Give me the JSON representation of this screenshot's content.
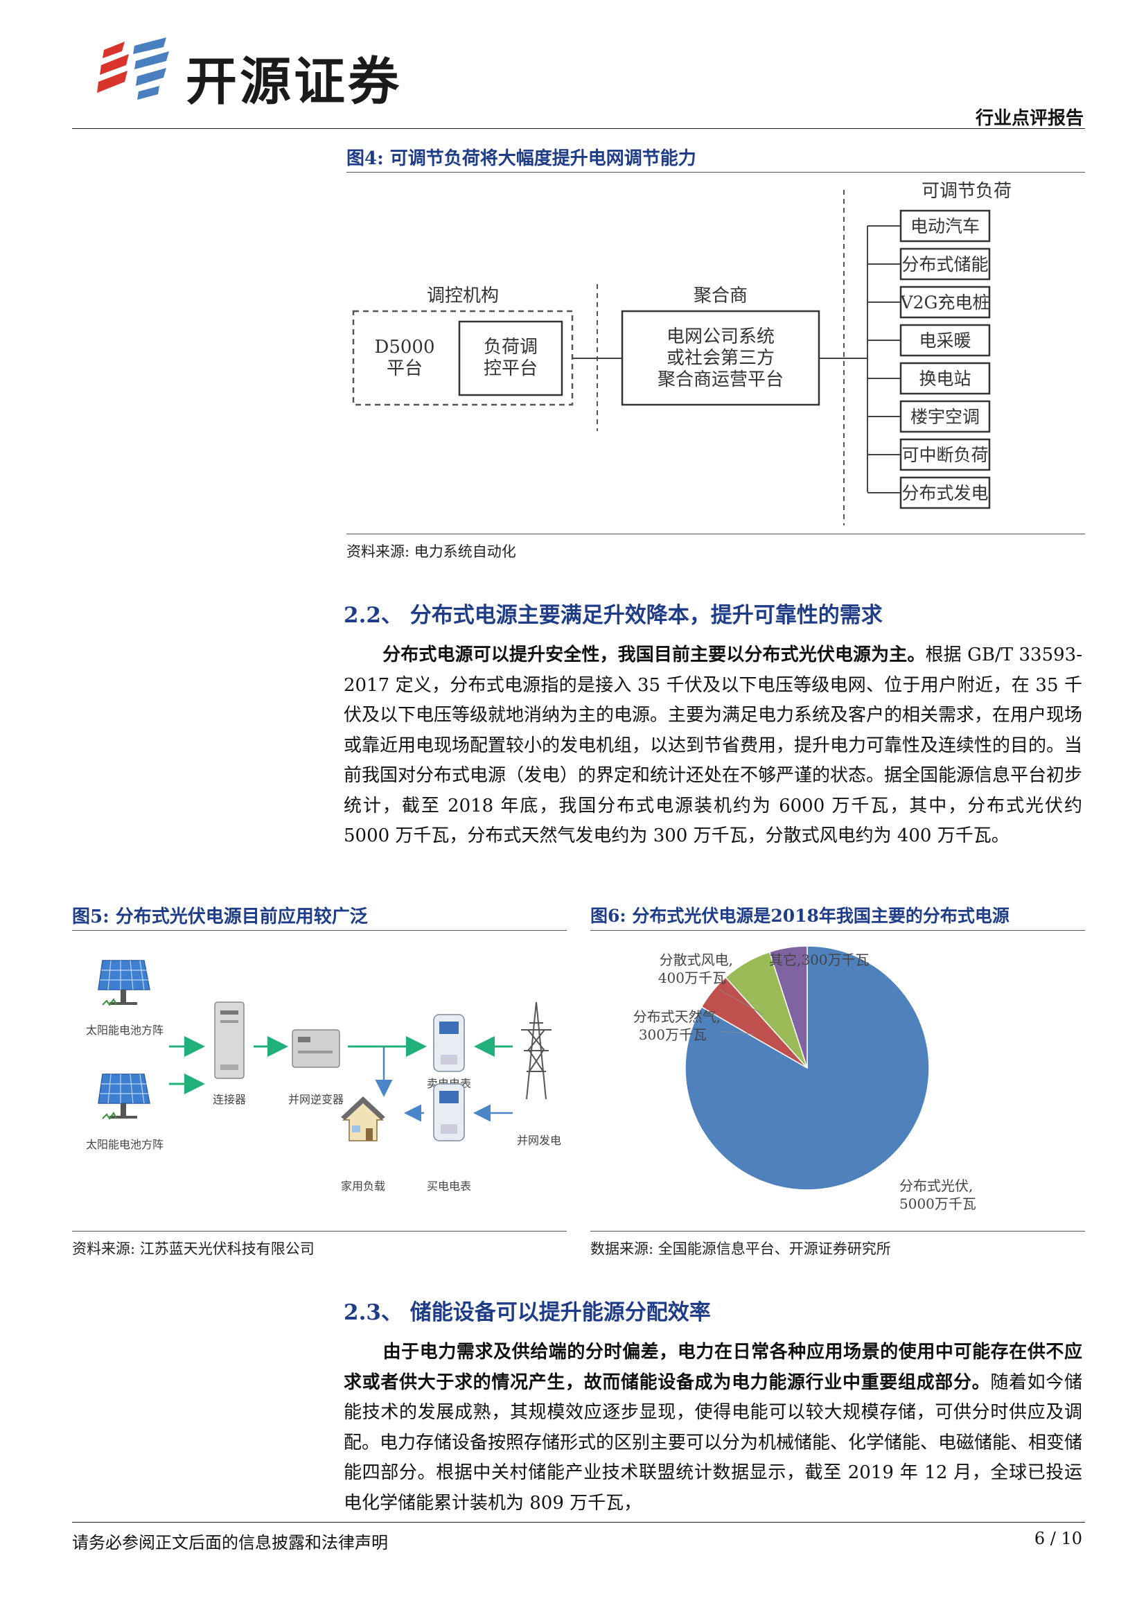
{
  "header": {
    "brand": "开源证券",
    "report_type": "行业点评报告"
  },
  "figure4": {
    "title": "图4:  可调节负荷将大幅度提升电网调节能力",
    "control_label": "调控机构",
    "d5000": [
      "D5000",
      "平台"
    ],
    "load_platform": [
      "负荷调",
      "控平台"
    ],
    "aggregator_label": "聚合商",
    "aggregator_box": [
      "电网公司系统",
      "或社会第三方",
      "聚合商运营平台"
    ],
    "adjustable_label": "可调节负荷",
    "loads": [
      "电动汽车",
      "分布式储能",
      "V2G充电桩",
      "电采暖",
      "换电站",
      "楼宇空调",
      "可中断负荷",
      "分布式发电"
    ],
    "source": "资料来源: 电力系统自动化"
  },
  "section22": {
    "title": "2.2、 分布式电源主要满足升效降本，提升可靠性的需求",
    "lead": "分布式电源可以提升安全性，我国目前主要以分布式光伏电源为主。",
    "body": "根据 GB/T 33593-2017 定义，分布式电源指的是接入 35 千伏及以下电压等级电网、位于用户附近，在 35 千伏及以下电压等级就地消纳为主的电源。主要为满足电力系统及客户的相关需求，在用户现场或靠近用电现场配置较小的发电机组，以达到节省费用，提升电力可靠性及连续性的目的。当前我国对分布式电源（发电）的界定和统计还处在不够严谨的状态。据全国能源信息平台初步统计，截至 2018 年底，我国分布式电源装机约为 6000 万千瓦，其中，分布式光伏约 5000 万千瓦，分布式天然气发电约为 300 万千瓦，分散式风电约为 400 万千瓦。"
  },
  "figure5": {
    "title": "图5:  分布式光伏电源目前应用较广泛",
    "labels": {
      "panel1": "太阳能电池方阵",
      "panel2": "太阳能电池方阵",
      "connector": "连接器",
      "inverter": "并网逆变器",
      "sell_meter": "卖电电表",
      "buy_meter": "买电电表",
      "home": "家用负载",
      "grid": "并网发电"
    },
    "source": "资料来源: 江苏蓝天光伏科技有限公司"
  },
  "figure6": {
    "title": "图6:  分布式光伏电源是2018年我国主要的分布式电源",
    "source": "数据来源: 全国能源信息平台、开源证券研究所",
    "colors": [
      "#4f81bd",
      "#c0504d",
      "#9bbb59",
      "#8064a2"
    ]
  },
  "chart_data": {
    "type": "pie",
    "unit": "万千瓦",
    "slices": [
      {
        "name": "分布式光伏",
        "value": 5000,
        "label_lines": [
          "分布式光伏,",
          "5000万千瓦"
        ]
      },
      {
        "name": "分布式天然气",
        "value": 300,
        "label_lines": [
          "分布式天然气,",
          "300万千瓦"
        ]
      },
      {
        "name": "分散式风电",
        "value": 400,
        "label_lines": [
          "分散式风电,",
          "400万千瓦"
        ]
      },
      {
        "name": "其它",
        "value": 300,
        "label_lines": [
          "其它,300万千瓦"
        ]
      }
    ]
  },
  "section23": {
    "title": "2.3、 储能设备可以提升能源分配效率",
    "lead": "由于电力需求及供给端的分时偏差，电力在日常各种应用场景的使用中可能存在供不应求或者供大于求的情况产生，故而储能设备成为电力能源行业中重要组成部分。",
    "body": "随着如今储能技术的发展成熟，其规模效应逐步显现，使得电能可以较大规模存储，可供分时供应及调配。电力存储设备按照存储形式的区别主要可以分为机械储能、化学储能、电磁储能、相变储能四部分。根据中关村储能产业技术联盟统计数据显示，截至 2019 年 12 月，全球已投运电化学储能累计装机为 809 万千瓦，"
  },
  "footer": {
    "disclaimer": "请务必参阅正文后面的信息披露和法律声明",
    "page": "6 / 10"
  }
}
